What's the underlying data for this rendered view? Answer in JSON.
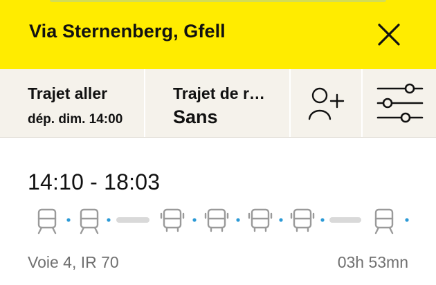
{
  "header": {
    "title": "Via Sternenberg, Gfell",
    "background_color": "#ffec00",
    "close_icon": "close-icon"
  },
  "toolbar": {
    "outbound": {
      "label": "Trajet aller",
      "value": "dép. dim. 14:00"
    },
    "return": {
      "label": "Trajet de r…",
      "value": "Sans"
    },
    "add_traveller_icon": "add-person-icon",
    "filter_icon": "sliders-icon",
    "background_color": "#f5f2eb"
  },
  "connection": {
    "times": "14:10 - 18:03",
    "platform_info": "Voie 4, IR 70",
    "duration": "03h 53mn",
    "legs": [
      "train",
      "train",
      "walk",
      "bus",
      "bus",
      "bus",
      "bus",
      "walk",
      "train"
    ],
    "accent_color": "#2c9ad6"
  }
}
